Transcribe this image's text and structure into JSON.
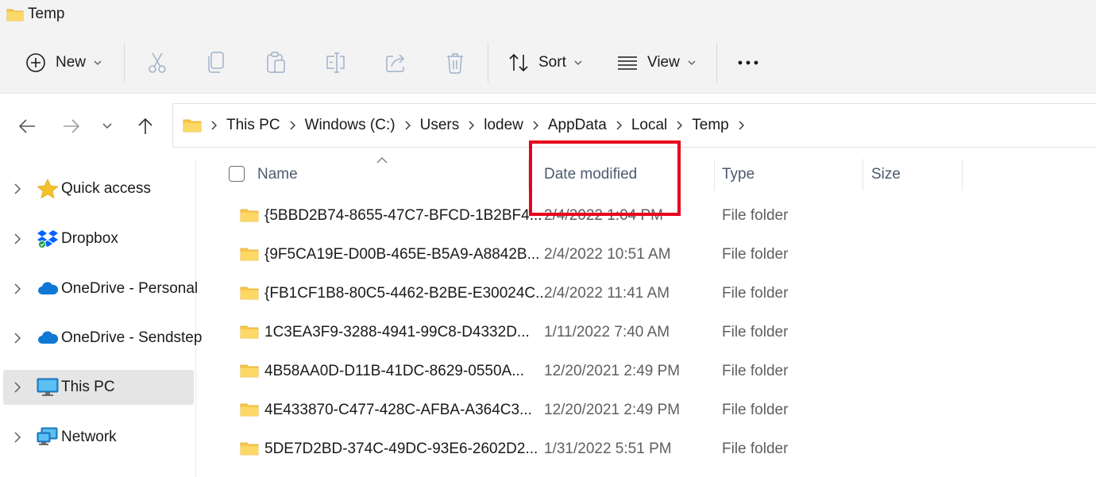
{
  "window": {
    "title": "Temp"
  },
  "toolbar": {
    "new_label": "New",
    "sort_label": "Sort",
    "view_label": "View",
    "buttons": [
      "cut-icon",
      "copy-icon",
      "paste-icon",
      "rename-icon",
      "share-icon",
      "delete-icon",
      "more-icon"
    ]
  },
  "address": {
    "crumbs": [
      "This PC",
      "Windows (C:)",
      "Users",
      "lodew",
      "AppData",
      "Local",
      "Temp"
    ]
  },
  "sidebar": {
    "items": [
      {
        "label": "Quick access",
        "icon": "star-icon"
      },
      {
        "label": "Dropbox",
        "icon": "dropbox-icon"
      },
      {
        "label": "OneDrive - Personal",
        "icon": "cloud-icon"
      },
      {
        "label": "OneDrive - Sendstep",
        "icon": "cloud-icon"
      },
      {
        "label": "This PC",
        "icon": "monitor-icon",
        "selected": true
      },
      {
        "label": "Network",
        "icon": "network-icon"
      }
    ]
  },
  "list": {
    "columns": {
      "name": "Name",
      "date": "Date modified",
      "type": "Type",
      "size": "Size"
    },
    "rows": [
      {
        "name": "{5BBD2B74-8655-47C7-BFCD-1B2BF4...",
        "date": "2/4/2022 1:04 PM",
        "type": "File folder"
      },
      {
        "name": "{9F5CA19E-D00B-465E-B5A9-A8842B...",
        "date": "2/4/2022 10:51 AM",
        "type": "File folder"
      },
      {
        "name": "{FB1CF1B8-80C5-4462-B2BE-E30024C...",
        "date": "2/4/2022 11:41 AM",
        "type": "File folder"
      },
      {
        "name": "1C3EA3F9-3288-4941-99C8-D4332D...",
        "date": "1/11/2022 7:40 AM",
        "type": "File folder"
      },
      {
        "name": "4B58AA0D-D11B-41DC-8629-0550A...",
        "date": "12/20/2021 2:49 PM",
        "type": "File folder"
      },
      {
        "name": "4E433870-C477-428C-AFBA-A364C3...",
        "date": "12/20/2021 2:49 PM",
        "type": "File folder"
      },
      {
        "name": "5DE7D2BD-374C-49DC-93E6-2602D2...",
        "date": "1/31/2022 5:51 PM",
        "type": "File folder"
      }
    ]
  },
  "colors": {
    "highlight": "#e8001c",
    "folder": "#f8c84a",
    "accent": "#0f6cbd"
  }
}
